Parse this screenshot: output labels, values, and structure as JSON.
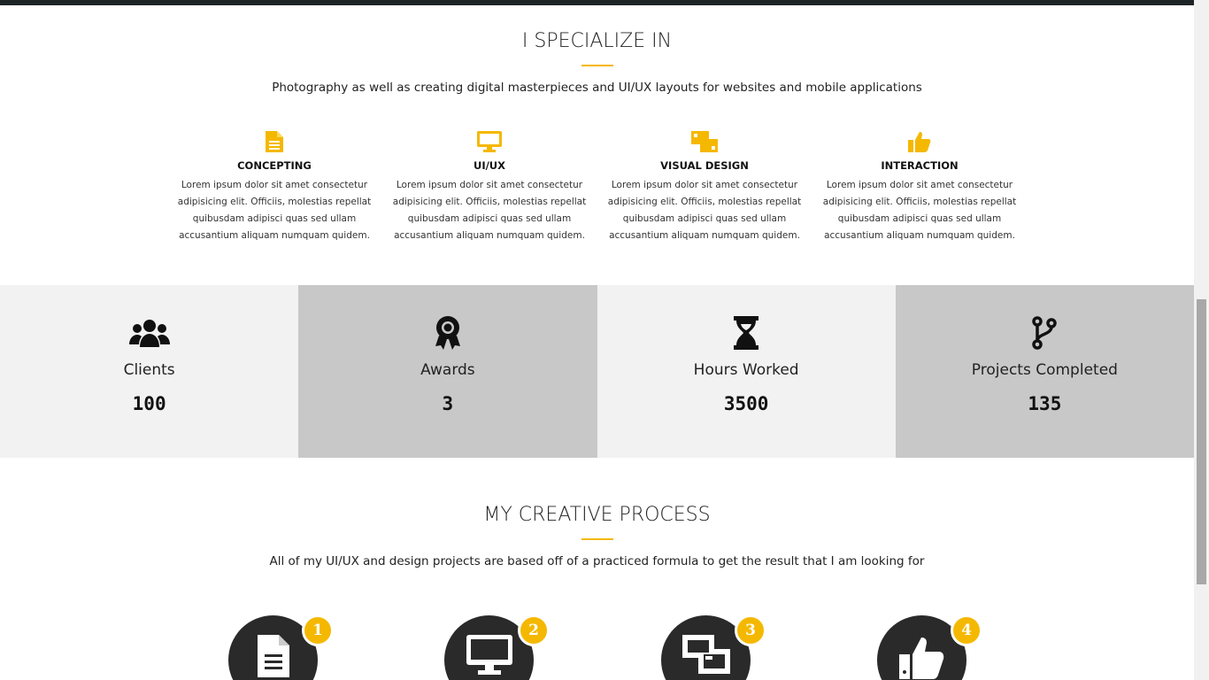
{
  "specialize": {
    "title": "I SPECIALIZE IN",
    "subtitle": "Photography as well as creating digital masterpieces and UI/UX layouts for websites and mobile applications",
    "items": [
      {
        "icon": "file-text-icon",
        "label": "CONCEPTING",
        "desc": "Lorem ipsum dolor sit amet consectetur adipisicing elit. Officiis, molestias repellat quibusdam adipisci quas sed ullam accusantium aliquam numquam quidem."
      },
      {
        "icon": "desktop-icon",
        "label": "UI/UX",
        "desc": "Lorem ipsum dolor sit amet consectetur adipisicing elit. Officiis, molestias repellat quibusdam adipisci quas sed ullam accusantium aliquam numquam quidem."
      },
      {
        "icon": "object-ungroup-icon",
        "label": "VISUAL DESIGN",
        "desc": "Lorem ipsum dolor sit amet consectetur adipisicing elit. Officiis, molestias repellat quibusdam adipisci quas sed ullam accusantium aliquam numquam quidem."
      },
      {
        "icon": "thumbs-up-icon",
        "label": "INTERACTION",
        "desc": "Lorem ipsum dolor sit amet consectetur adipisicing elit. Officiis, molestias repellat quibusdam adipisci quas sed ullam accusantium aliquam numquam quidem."
      }
    ]
  },
  "stats": [
    {
      "icon": "users-icon",
      "name": "Clients",
      "value": "100"
    },
    {
      "icon": "award-icon",
      "name": "Awards",
      "value": "3"
    },
    {
      "icon": "hourglass-icon",
      "name": "Hours Worked",
      "value": "3500"
    },
    {
      "icon": "code-branch-icon",
      "name": "Projects Completed",
      "value": "135"
    }
  ],
  "process": {
    "title": "MY CREATIVE PROCESS",
    "subtitle": "All of my UI/UX and design projects are based off of a practiced formula to get the result that I am looking for",
    "steps": [
      {
        "icon": "file-text-icon",
        "badge": "1"
      },
      {
        "icon": "desktop-icon",
        "badge": "2"
      },
      {
        "icon": "object-ungroup-icon",
        "badge": "3"
      },
      {
        "icon": "thumbs-up-icon",
        "badge": "4"
      }
    ]
  },
  "colors": {
    "accent": "#f5b800",
    "stat_light": "#f2f2f2",
    "stat_dark": "#c8c8c8",
    "circle": "#2a2a2a"
  }
}
